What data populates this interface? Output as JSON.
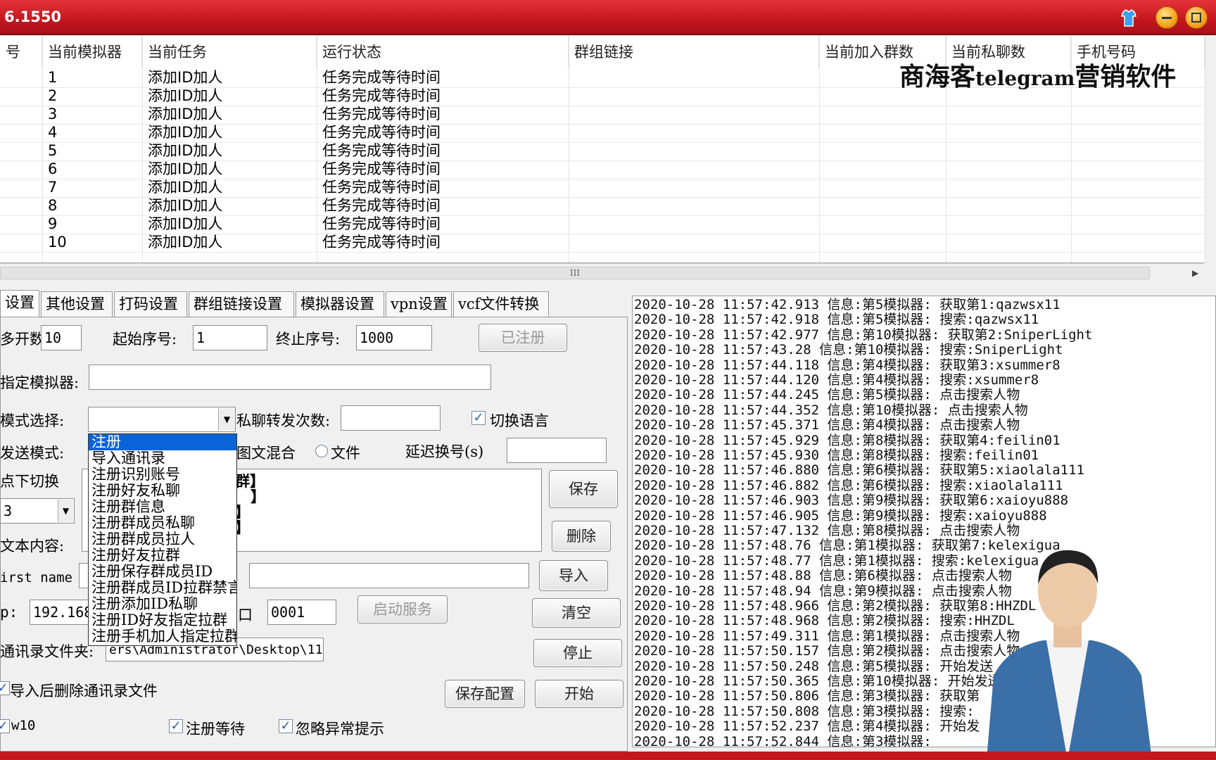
{
  "window": {
    "title": "6.1550"
  },
  "table": {
    "headers": [
      "号",
      "当前模拟器",
      "当前任务",
      "运行状态",
      "群组链接",
      "当前加入群数",
      "当前私聊数",
      "手机号码"
    ],
    "rows": [
      {
        "sim": "1",
        "task": "添加ID加人",
        "status": "任务完成等待时间"
      },
      {
        "sim": "2",
        "task": "添加ID加人",
        "status": "任务完成等待时间"
      },
      {
        "sim": "3",
        "task": "添加ID加人",
        "status": "任务完成等待时间"
      },
      {
        "sim": "4",
        "task": "添加ID加人",
        "status": "任务完成等待时间"
      },
      {
        "sim": "5",
        "task": "添加ID加人",
        "status": "任务完成等待时间"
      },
      {
        "sim": "6",
        "task": "添加ID加人",
        "status": "任务完成等待时间"
      },
      {
        "sim": "7",
        "task": "添加ID加人",
        "status": "任务完成等待时间"
      },
      {
        "sim": "8",
        "task": "添加ID加人",
        "status": "任务完成等待时间"
      },
      {
        "sim": "9",
        "task": "添加ID加人",
        "status": "任务完成等待时间"
      },
      {
        "sim": "10",
        "task": "添加ID加人",
        "status": "任务完成等待时间"
      }
    ],
    "scroll_thumb": "III"
  },
  "brand": {
    "cn1": "商海客",
    "en": "telegram",
    "cn2": "营销软件"
  },
  "tabs": [
    "设置",
    "其他设置",
    "打码设置",
    "群组链接设置",
    "模拟器设置",
    "vpn设置",
    "vcf文件转换"
  ],
  "form": {
    "open_count_label": "多开数",
    "open_count": "10",
    "start_label": "起始序号:",
    "start": "1",
    "end_label": "终止序号:",
    "end": "1000",
    "registered_btn": "已注册",
    "sim_label": "指定模拟器:",
    "sim_value": "",
    "mode_label": "模式选择:",
    "mode_value": "",
    "pm_label": "私聊转发次数:",
    "pm_value": "",
    "switch_lang": "切换语言",
    "send_label": "发送模式:",
    "opt_mixed": "图文混合",
    "opt_file": "文件",
    "delay_label": "延迟换号(s)",
    "delay_value": "",
    "switch_label": "点下切换",
    "switch_value": "3",
    "text_label": "文本内容:",
    "text_frag1": "群】",
    "text_frag2": "】",
    "text_frag3": "】",
    "text_frag4": "】",
    "fn_label": "irst name",
    "fn_value": "",
    "ip_label": "p:",
    "ip_value": "192.168",
    "port_label": "口",
    "port_value": "0001",
    "start_service": "启动服务",
    "contacts_label": "通讯录文件夹:",
    "contacts_value": "ers\\Administrator\\Desktop\\11",
    "del_after": "导入后删除通讯录文件",
    "w10": "w10",
    "reg_wait": "注册等待",
    "ignore_err": "忽略异常提示",
    "save_cfg": "保存配置",
    "btn_save": "保存",
    "btn_delete": "删除",
    "btn_import": "导入",
    "btn_clear": "清空",
    "btn_stop": "停止",
    "btn_start": "开始"
  },
  "dropdown": [
    "注册",
    "导入通讯录",
    "注册识别账号",
    "注册好友私聊",
    "注册群信息",
    "注册群成员私聊",
    "注册群成员拉人",
    "注册好友拉群",
    "注册保存群成员ID",
    "注册群成员ID拉群禁言",
    "注册添加ID私聊",
    "注册ID好友指定拉群",
    "注册手机加人指定拉群"
  ],
  "log": [
    "2020-10-28 11:57:42.913 信息:第5模拟器:  获取第1:qazwsx11",
    "2020-10-28 11:57:42.918 信息:第5模拟器:  搜索:qazwsx11",
    "2020-10-28 11:57:42.977 信息:第10模拟器:  获取第2:SniperLight",
    "2020-10-28 11:57:43.28 信息:第10模拟器:  搜索:SniperLight",
    "2020-10-28 11:57:44.118 信息:第4模拟器:  获取第3:xsummer8",
    "2020-10-28 11:57:44.120 信息:第4模拟器:  搜索:xsummer8",
    "2020-10-28 11:57:44.245 信息:第5模拟器:  点击搜索人物",
    "2020-10-28 11:57:44.352 信息:第10模拟器:  点击搜索人物",
    "2020-10-28 11:57:45.371 信息:第4模拟器:  点击搜索人物",
    "2020-10-28 11:57:45.929 信息:第8模拟器:  获取第4:feilin01",
    "2020-10-28 11:57:45.930 信息:第8模拟器:  搜索:feilin01",
    "2020-10-28 11:57:46.880 信息:第6模拟器:  获取第5:xiaolala111",
    "2020-10-28 11:57:46.882 信息:第6模拟器:  搜索:xiaolala111",
    "2020-10-28 11:57:46.903 信息:第9模拟器:  获取第6:xaioyu888",
    "2020-10-28 11:57:46.905 信息:第9模拟器:  搜索:xaioyu888",
    "2020-10-28 11:57:47.132 信息:第8模拟器:  点击搜索人物",
    "2020-10-28 11:57:48.76 信息:第1模拟器:  获取第7:kelexigua",
    "2020-10-28 11:57:48.77 信息:第1模拟器:  搜索:kelexigua",
    "2020-10-28 11:57:48.88 信息:第6模拟器:  点击搜索人物",
    "2020-10-28 11:57:48.94 信息:第9模拟器:  点击搜索人物",
    "2020-10-28 11:57:48.966 信息:第2模拟器:  获取第8:HHZDL",
    "2020-10-28 11:57:48.968 信息:第2模拟器:  搜索:HHZDL",
    "2020-10-28 11:57:49.311 信息:第1模拟器:  点击搜索人物",
    "2020-10-28 11:57:50.157 信息:第2模拟器:  点击搜索人物",
    "2020-10-28 11:57:50.248 信息:第5模拟器:  开始发送",
    "2020-10-28 11:57:50.365 信息:第10模拟器:  开始发送",
    "2020-10-28 11:57:50.806 信息:第3模拟器:  获取第",
    "2020-10-28 11:57:50.808 信息:第3模拟器:  搜索:",
    "2020-10-28 11:57:52.237 信息:第4模拟器:  开始发",
    "2020-10-28 11:57:52.844 信息:第3模拟器:"
  ],
  "colors": {
    "titlebar": "#c4161e",
    "selection": "#0a64d8"
  }
}
